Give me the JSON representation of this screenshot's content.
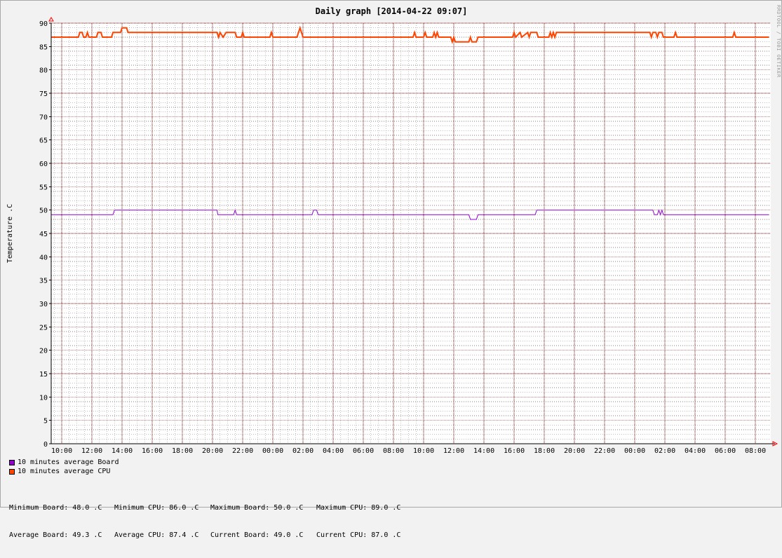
{
  "chart_data": {
    "type": "line",
    "title": "Daily graph [2014-04-22 09:07]",
    "ylabel": "Temperature .C",
    "xlabel": "",
    "ylim": [
      0,
      90
    ],
    "xlim": [
      9.5,
      33.5
    ],
    "y_ticks": [
      0,
      5,
      10,
      15,
      20,
      25,
      30,
      35,
      40,
      45,
      50,
      55,
      60,
      65,
      70,
      75,
      80,
      85,
      90
    ],
    "x_ticks": [
      {
        "x": 10,
        "label": "10:00"
      },
      {
        "x": 12,
        "label": "12:00"
      },
      {
        "x": 14,
        "label": "14:00"
      },
      {
        "x": 16,
        "label": "16:00"
      },
      {
        "x": 18,
        "label": "18:00"
      },
      {
        "x": 20,
        "label": "20:00"
      },
      {
        "x": 22,
        "label": "22:00"
      },
      {
        "x": 24,
        "label": "00:00"
      },
      {
        "x": 26,
        "label": "02:00"
      },
      {
        "x": 28,
        "label": "04:00"
      },
      {
        "x": 30,
        "label": "06:00"
      },
      {
        "x": 32,
        "label": "08:00"
      },
      {
        "x": 34,
        "label": "10:00"
      },
      {
        "x": 36,
        "label": "12:00"
      },
      {
        "x": 38,
        "label": "14:00"
      },
      {
        "x": 40,
        "label": "16:00"
      },
      {
        "x": 42,
        "label": "18:00"
      },
      {
        "x": 44,
        "label": "20:00"
      },
      {
        "x": 46,
        "label": "22:00"
      },
      {
        "x": 48,
        "label": "00:00"
      },
      {
        "x": 50,
        "label": "02:00"
      },
      {
        "x": 52,
        "label": "04:00"
      },
      {
        "x": 54,
        "label": "06:00"
      },
      {
        "x": 56,
        "label": "08:00"
      }
    ],
    "grid": true,
    "legend_position": "bottom-left",
    "series": [
      {
        "name": "10 minutes average Board",
        "color": "#9400d3",
        "points": [
          [
            9.3,
            49
          ],
          [
            13.4,
            49
          ],
          [
            13.5,
            50
          ],
          [
            20.3,
            50
          ],
          [
            20.35,
            49
          ],
          [
            21.4,
            49
          ],
          [
            21.5,
            50
          ],
          [
            21.6,
            49
          ],
          [
            26.6,
            49
          ],
          [
            26.7,
            50
          ],
          [
            26.9,
            50
          ],
          [
            27.0,
            49
          ],
          [
            37.0,
            49
          ],
          [
            37.1,
            48
          ],
          [
            37.5,
            48
          ],
          [
            37.6,
            49
          ],
          [
            41.4,
            49
          ],
          [
            41.5,
            50
          ],
          [
            49.2,
            50
          ],
          [
            49.3,
            49
          ],
          [
            49.5,
            49
          ],
          [
            49.6,
            50
          ],
          [
            49.7,
            49
          ],
          [
            49.8,
            50
          ],
          [
            49.9,
            49
          ],
          [
            56.9,
            49
          ]
        ]
      },
      {
        "name": "10 minutes average CPU",
        "color": "#ff4500",
        "points": [
          [
            9.3,
            87
          ],
          [
            11.1,
            87
          ],
          [
            11.2,
            88
          ],
          [
            11.35,
            88
          ],
          [
            11.45,
            87
          ],
          [
            11.6,
            87
          ],
          [
            11.7,
            88
          ],
          [
            11.8,
            87
          ],
          [
            12.3,
            87
          ],
          [
            12.4,
            88
          ],
          [
            12.6,
            88
          ],
          [
            12.7,
            87
          ],
          [
            13.3,
            87
          ],
          [
            13.4,
            88
          ],
          [
            13.9,
            88
          ],
          [
            14.0,
            89
          ],
          [
            14.3,
            89
          ],
          [
            14.4,
            88
          ],
          [
            20.3,
            88
          ],
          [
            20.4,
            87
          ],
          [
            20.5,
            88
          ],
          [
            20.7,
            87
          ],
          [
            20.9,
            88
          ],
          [
            21.5,
            88
          ],
          [
            21.6,
            87
          ],
          [
            21.9,
            87
          ],
          [
            22.0,
            88
          ],
          [
            22.1,
            87
          ],
          [
            23.8,
            87
          ],
          [
            23.9,
            88
          ],
          [
            24.0,
            87
          ],
          [
            25.6,
            87
          ],
          [
            25.7,
            88
          ],
          [
            25.8,
            89
          ],
          [
            25.9,
            88
          ],
          [
            26.0,
            87
          ],
          [
            33.3,
            87
          ],
          [
            33.4,
            88
          ],
          [
            33.5,
            87
          ],
          [
            34.0,
            87
          ],
          [
            34.1,
            88
          ],
          [
            34.2,
            87
          ],
          [
            34.6,
            87
          ],
          [
            34.7,
            88
          ],
          [
            34.8,
            87
          ],
          [
            34.9,
            88
          ],
          [
            35.0,
            87
          ],
          [
            35.8,
            87
          ],
          [
            35.9,
            86
          ],
          [
            36.0,
            87
          ],
          [
            36.1,
            86
          ],
          [
            37.0,
            86
          ],
          [
            37.1,
            87
          ],
          [
            37.2,
            86
          ],
          [
            37.5,
            86
          ],
          [
            37.6,
            87
          ],
          [
            39.9,
            87
          ],
          [
            40.0,
            88
          ],
          [
            40.1,
            87
          ],
          [
            40.4,
            88
          ],
          [
            40.5,
            87
          ],
          [
            40.9,
            88
          ],
          [
            41.0,
            87
          ],
          [
            41.1,
            88
          ],
          [
            41.5,
            88
          ],
          [
            41.6,
            87
          ],
          [
            42.3,
            87
          ],
          [
            42.4,
            88
          ],
          [
            42.5,
            87
          ],
          [
            42.6,
            88
          ],
          [
            42.7,
            87
          ],
          [
            42.8,
            88
          ],
          [
            43.3,
            88
          ],
          [
            49.0,
            88
          ],
          [
            49.1,
            87
          ],
          [
            49.2,
            88
          ],
          [
            49.4,
            88
          ],
          [
            49.5,
            87
          ],
          [
            49.6,
            88
          ],
          [
            49.8,
            88
          ],
          [
            49.9,
            87
          ],
          [
            50.6,
            87
          ],
          [
            50.7,
            88
          ],
          [
            50.8,
            87
          ],
          [
            54.5,
            87
          ],
          [
            54.6,
            88
          ],
          [
            54.7,
            87
          ],
          [
            56.9,
            87
          ]
        ]
      }
    ]
  },
  "legend": {
    "items": [
      {
        "label": "10 minutes average Board",
        "color": "#9400d3"
      },
      {
        "label": "10 minutes average CPU",
        "color": "#ff4500"
      }
    ]
  },
  "stats": {
    "row1": [
      "Minimum Board: 48.0 .C",
      "Minimum CPU: 86.0 .C",
      "Maximum Board: 50.0 .C",
      "Maximum CPU: 89.0 .C"
    ],
    "row2": [
      "Average Board: 49.3 .C",
      "Average CPU: 87.4 .C",
      "Current Board: 49.0 .C",
      "Current CPU: 87.0 .C"
    ]
  },
  "credit": "RRDTOOL / TOBI OETIKER",
  "colors": {
    "background": "#f2f2f2",
    "plot_background": "#ffffff",
    "major_grid": "#800000",
    "minor_grid": "#808080"
  }
}
